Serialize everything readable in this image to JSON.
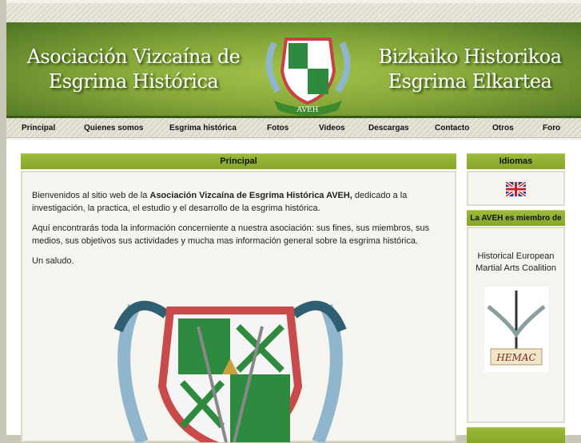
{
  "banner": {
    "title_es_line1": "Asociación Vizcaína de",
    "title_es_line2": "Esgrima Histórica",
    "title_eu_line1": "Bizkaiko Historikoa",
    "title_eu_line2": "Esgrima Elkartea",
    "crest_label": "AVEH"
  },
  "nav": [
    {
      "label": "Principal"
    },
    {
      "label": "Quienes somos"
    },
    {
      "label": "Esgrima histórica"
    },
    {
      "label": "Fotos"
    },
    {
      "label": "Videos"
    },
    {
      "label": "Descargas"
    },
    {
      "label": "Contacto"
    },
    {
      "label": "Otros"
    },
    {
      "label": "Foro"
    }
  ],
  "main": {
    "title": "Principal",
    "p1_pre": "Bienvenidos al sitio web de la ",
    "p1_bold": "Asociación Vizcaína de Esgrima Histórica AVEH,",
    "p1_post": " dedicado a la investigación, la practica, el estudio y el desarrollo de la esgrima histórica.",
    "p2": "Aquí encontrarás toda la información concerniente a nuestra asociación: sus fines, sus miembros, sus medios, sus objetivos sus actividades y mucha mas información general sobre la esgrima histórica.",
    "p3": "Un saludo."
  },
  "sidebar": {
    "languages_title": "Idiomas",
    "member_title": "La AVEH es miembro de",
    "member_org": "Historical European Martial Arts Coalition",
    "member_logo_text": "HEMAC"
  }
}
